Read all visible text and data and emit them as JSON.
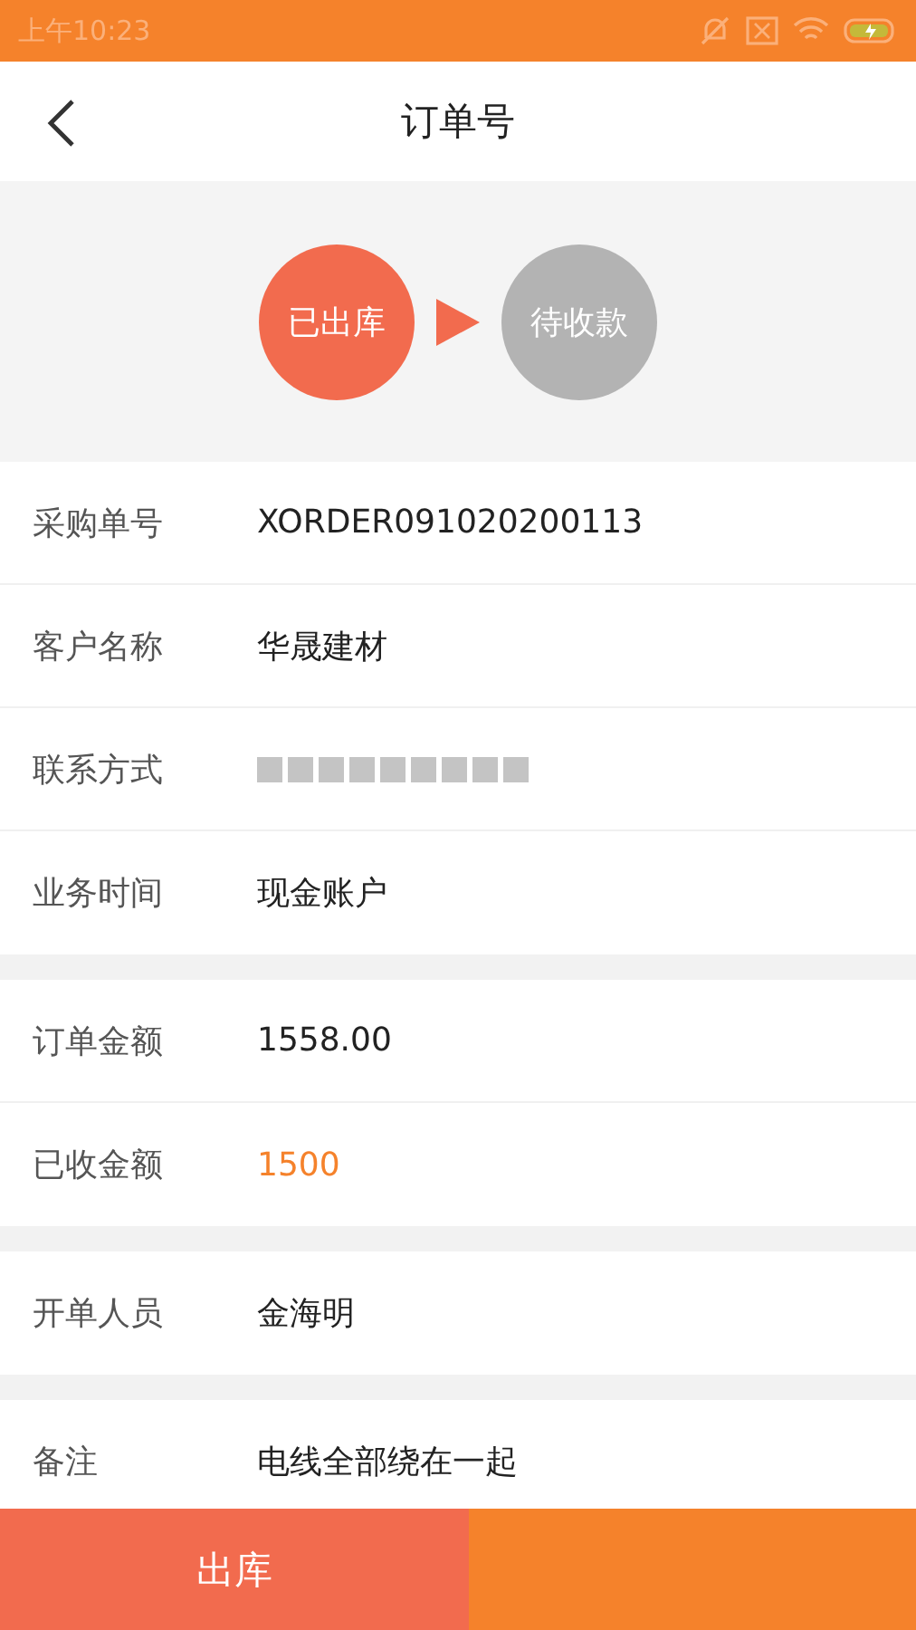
{
  "status_bar": {
    "time": "上午10:23"
  },
  "header": {
    "title": "订单号"
  },
  "steps": [
    {
      "label": "已出库",
      "done": true
    },
    {
      "label": "待收款",
      "done": false
    }
  ],
  "groups": [
    {
      "rows": [
        {
          "label": "采购单号",
          "value": "XORDER091020200113"
        },
        {
          "label": "客户名称",
          "value": "华晟建材"
        },
        {
          "label": "联系方式",
          "redacted": true
        },
        {
          "label": "业务时间",
          "value": "现金账户"
        }
      ]
    },
    {
      "rows": [
        {
          "label": "订单金额",
          "value": "1558.00"
        },
        {
          "label": "已收金额",
          "value": "1500",
          "highlight": true
        }
      ]
    },
    {
      "rows": [
        {
          "label": "开单人员",
          "value": "金海明"
        }
      ]
    },
    {
      "rows": [
        {
          "label": "备注",
          "value": "电线全部绕在一起"
        }
      ]
    }
  ],
  "bottom_bar": {
    "primary": {
      "label": "出库"
    }
  }
}
